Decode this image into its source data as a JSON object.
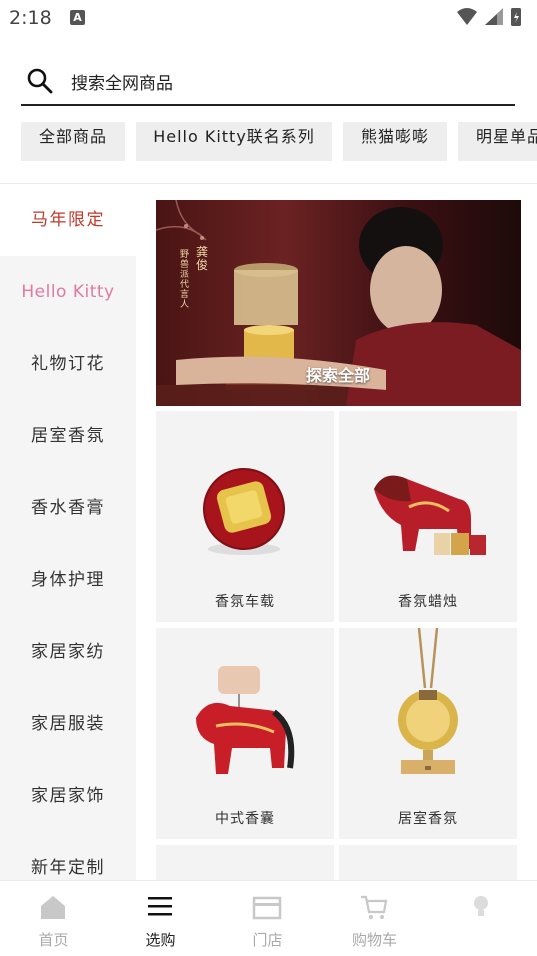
{
  "status_bar": {
    "time": "2:18",
    "notification_badge": "A"
  },
  "search": {
    "placeholder": "搜索全网商品"
  },
  "chips": [
    {
      "label": "全部商品"
    },
    {
      "label": "Hello Kitty联名系列"
    },
    {
      "label": "熊猫嘭嘭"
    },
    {
      "label": "明星单品"
    }
  ],
  "sidebar": {
    "items": [
      {
        "label": "马年限定"
      },
      {
        "label": "Hello Kitty"
      },
      {
        "label": "礼物订花"
      },
      {
        "label": "居室香氛"
      },
      {
        "label": "香水香膏"
      },
      {
        "label": "身体护理"
      },
      {
        "label": "家居家纺"
      },
      {
        "label": "家居服装"
      },
      {
        "label": "家居家饰"
      },
      {
        "label": "新年定制"
      }
    ]
  },
  "banner": {
    "cta": "探索全部",
    "vertical_text": "野兽派代言人",
    "name": "龚俊"
  },
  "products": [
    {
      "label": "香氛车载"
    },
    {
      "label": "香氛蜡烛"
    },
    {
      "label": "中式香囊"
    },
    {
      "label": "居室香氛"
    }
  ],
  "bottom_nav": [
    {
      "label": "首页",
      "icon": "home-icon"
    },
    {
      "label": "选购",
      "icon": "menu-icon"
    },
    {
      "label": "门店",
      "icon": "store-icon"
    },
    {
      "label": "购物车",
      "icon": "cart-icon"
    },
    {
      "label": "",
      "icon": "lightbulb-icon"
    }
  ],
  "colors": {
    "accent": "#c0392b",
    "kitty": "#e07aa0",
    "nav_inactive": "#aaaaaa"
  }
}
